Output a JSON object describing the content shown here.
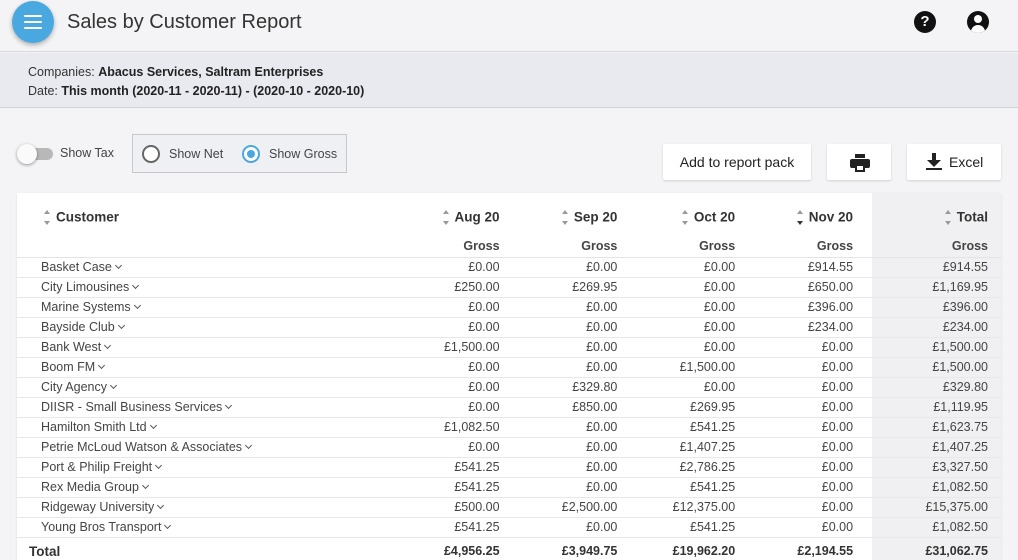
{
  "header": {
    "title": "Sales by Customer Report",
    "menu_icon": "hamburger-menu-icon",
    "help_icon": "help-icon",
    "help_glyph": "?",
    "account_icon": "account-icon"
  },
  "filters": {
    "companies_label": "Companies:",
    "companies_value": "Abacus Services, Saltram Enterprises",
    "date_label": "Date:",
    "date_value": "This month (2020-11 - 2020-11) - (2020-10 - 2020-10)"
  },
  "controls": {
    "show_tax_label": "Show Tax",
    "show_tax_on": false,
    "show_net_label": "Show Net",
    "show_gross_label": "Show Gross",
    "selected": "gross",
    "add_report_label": "Add to report pack",
    "excel_label": "Excel",
    "accent_color": "#4aa8e0"
  },
  "table": {
    "customer_header": "Customer",
    "months": [
      "Aug 20",
      "Sep 20",
      "Oct 20",
      "Nov 20"
    ],
    "total_header": "Total",
    "sub_header": "Gross",
    "rows": [
      {
        "name": "Basket Case",
        "values": [
          "£0.00",
          "£0.00",
          "£0.00",
          "£914.55"
        ],
        "total": "£914.55"
      },
      {
        "name": "City Limousines",
        "values": [
          "£250.00",
          "£269.95",
          "£0.00",
          "£650.00"
        ],
        "total": "£1,169.95"
      },
      {
        "name": "Marine Systems",
        "values": [
          "£0.00",
          "£0.00",
          "£0.00",
          "£396.00"
        ],
        "total": "£396.00"
      },
      {
        "name": "Bayside Club",
        "values": [
          "£0.00",
          "£0.00",
          "£0.00",
          "£234.00"
        ],
        "total": "£234.00"
      },
      {
        "name": "Bank West",
        "values": [
          "£1,500.00",
          "£0.00",
          "£0.00",
          "£0.00"
        ],
        "total": "£1,500.00"
      },
      {
        "name": "Boom FM",
        "values": [
          "£0.00",
          "£0.00",
          "£1,500.00",
          "£0.00"
        ],
        "total": "£1,500.00"
      },
      {
        "name": "City Agency",
        "values": [
          "£0.00",
          "£329.80",
          "£0.00",
          "£0.00"
        ],
        "total": "£329.80"
      },
      {
        "name": "DIISR - Small Business Services",
        "values": [
          "£0.00",
          "£850.00",
          "£269.95",
          "£0.00"
        ],
        "total": "£1,119.95"
      },
      {
        "name": "Hamilton Smith Ltd",
        "values": [
          "£1,082.50",
          "£0.00",
          "£541.25",
          "£0.00"
        ],
        "total": "£1,623.75"
      },
      {
        "name": "Petrie McLoud Watson & Associates",
        "values": [
          "£0.00",
          "£0.00",
          "£1,407.25",
          "£0.00"
        ],
        "total": "£1,407.25"
      },
      {
        "name": "Port & Philip Freight",
        "values": [
          "£541.25",
          "£0.00",
          "£2,786.25",
          "£0.00"
        ],
        "total": "£3,327.50"
      },
      {
        "name": "Rex Media Group",
        "values": [
          "£541.25",
          "£0.00",
          "£541.25",
          "£0.00"
        ],
        "total": "£1,082.50"
      },
      {
        "name": "Ridgeway University",
        "values": [
          "£500.00",
          "£2,500.00",
          "£12,375.00",
          "£0.00"
        ],
        "total": "£15,375.00"
      },
      {
        "name": "Young Bros Transport",
        "values": [
          "£541.25",
          "£0.00",
          "£541.25",
          "£0.00"
        ],
        "total": "£1,082.50"
      }
    ],
    "footer": {
      "label": "Total",
      "values": [
        "£4,956.25",
        "£3,949.75",
        "£19,962.20",
        "£2,194.55"
      ],
      "total": "£31,062.75"
    }
  }
}
